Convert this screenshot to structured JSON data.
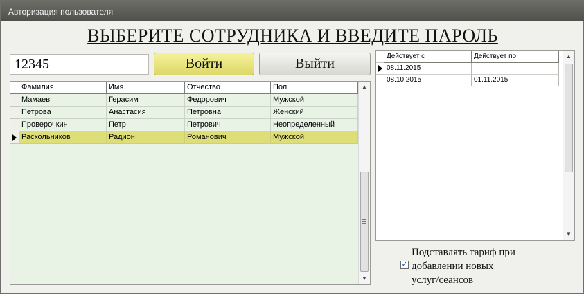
{
  "window": {
    "title": "Авторизация пользователя"
  },
  "heading": "ВЫБЕРИТЕ СОТРУДНИКА И ВВЕДИТЕ ПАРОЛЬ",
  "password": {
    "value": "12345"
  },
  "buttons": {
    "login": "Войти",
    "exit": "Выйти"
  },
  "users": {
    "columns": [
      "Фамилия",
      "Имя",
      "Отчество",
      "Пол"
    ],
    "rows": [
      [
        "Мамаев",
        "Герасим",
        "Федорович",
        "Мужской"
      ],
      [
        "Петрова",
        "Анастасия",
        "Петровна",
        "Женский"
      ],
      [
        "Проверочкин",
        "Петр",
        "Петрович",
        "Неопределенный"
      ],
      [
        "Раскольников",
        "Радион",
        "Романович",
        "Мужской"
      ]
    ],
    "current_row_index": 3
  },
  "periods": {
    "columns": [
      "Действует с",
      "Действует по"
    ],
    "rows": [
      [
        "08.11.2015",
        ""
      ],
      [
        "08.10.2015",
        "01.11.2015"
      ]
    ],
    "current_row_index": 0
  },
  "options": {
    "substitute_tariff": {
      "checked": true,
      "label_lines": [
        "Подставлять тариф при",
        "добавлении новых",
        "услуг/сеансов"
      ]
    }
  },
  "icons": {
    "scroll_up": "chevron-up-icon",
    "scroll_down": "chevron-down-icon",
    "row_pointer": "triangle-right-icon",
    "check": "checkmark-icon"
  }
}
